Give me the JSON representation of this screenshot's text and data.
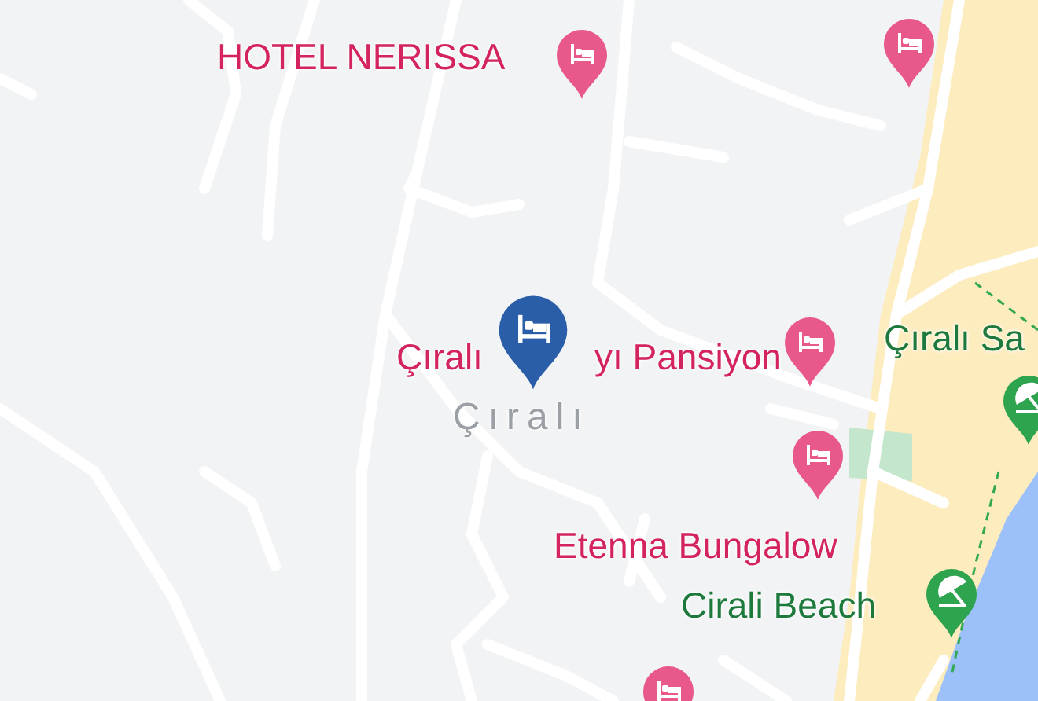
{
  "map": {
    "labels": [
      {
        "kind": "hotel",
        "text": "HOTEL NERISSA"
      },
      {
        "kind": "hotel",
        "text": "Çıralı"
      },
      {
        "kind": "hotel",
        "text": "yı Pansiyon"
      },
      {
        "kind": "place",
        "text": "Çıralı"
      },
      {
        "kind": "hotel",
        "text": "Etenna Bungalow"
      },
      {
        "kind": "beach",
        "text": "Çıralı Sa"
      },
      {
        "kind": "beach",
        "text": "Cirali Beach"
      }
    ],
    "pins": [
      {
        "kind": "hotel",
        "selected": false
      },
      {
        "kind": "hotel",
        "selected": false
      },
      {
        "kind": "hotel",
        "selected": false
      },
      {
        "kind": "hotel",
        "selected": false
      },
      {
        "kind": "hotel",
        "selected": false
      },
      {
        "kind": "beach",
        "selected": false
      },
      {
        "kind": "beach",
        "selected": false
      },
      {
        "kind": "hotel",
        "selected": true
      }
    ]
  }
}
